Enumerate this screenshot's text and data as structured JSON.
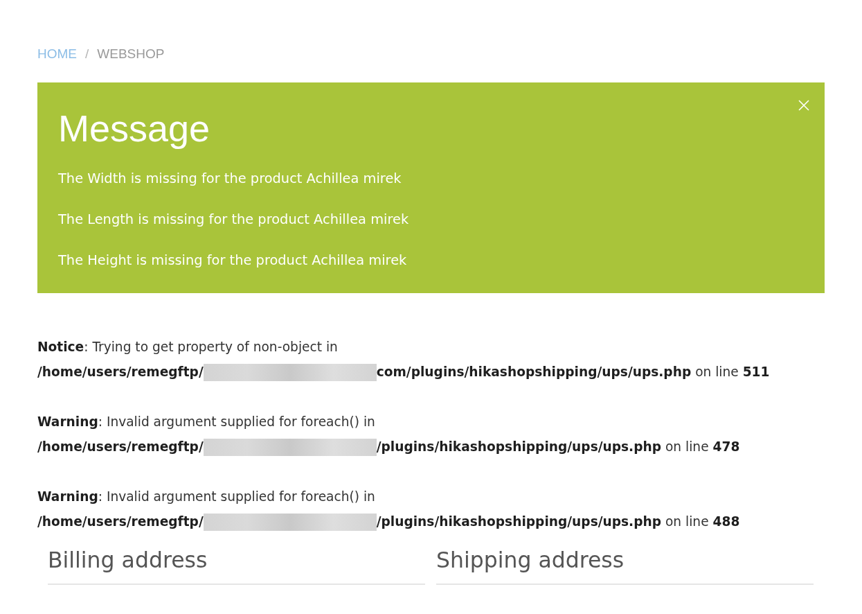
{
  "breadcrumb": {
    "items": [
      {
        "label": "HOME",
        "kind": "link"
      },
      {
        "label": "WEBSHOP",
        "kind": "current"
      }
    ],
    "separator": "/"
  },
  "message": {
    "title": "Message",
    "lines": [
      "The Width is missing for the product Achillea mirek",
      "The Length is missing for the product Achillea mirek",
      "The Height is missing for the product Achillea mirek"
    ]
  },
  "errors": [
    {
      "heading": "**Notice**: Trying to get property of non-object in",
      "path_start": "/home/users/remegftp/",
      "redacted": true,
      "path_rest": "**com/plugins/hikashopshipping/ups/ups.php** on line **511**"
    },
    {
      "heading": "**Warning**: Invalid argument supplied for foreach() in",
      "path_start": "/home/users/remegftp/",
      "redacted": true,
      "path_rest": "**/plugins/hikashopshipping/ups/ups.php** on line **478**"
    },
    {
      "heading": "**Warning**: Invalid argument supplied for foreach() in",
      "path_start": "/home/users/remegftp/",
      "redacted": true,
      "path_rest": "**/plugins/hikashopshipping/ups/ups.php** on line **488**"
    }
  ],
  "addresses": [
    {
      "title": "Billing address"
    },
    {
      "title": "Shipping address"
    }
  ]
}
